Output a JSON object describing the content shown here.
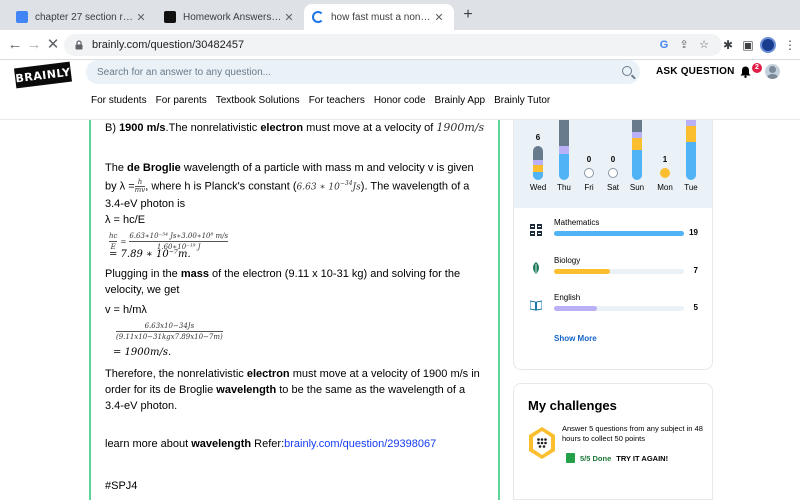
{
  "browser": {
    "tabs": [
      {
        "title": "chapter 27 section review 27.1",
        "favicon_color": "#4285f4"
      },
      {
        "title": "Homework Answers from Subje",
        "favicon_color": "#111111"
      },
      {
        "title": "how fast must a nonrelativistic",
        "favicon_color": "#1a73e8"
      }
    ],
    "url": "brainly.com/question/30482457"
  },
  "header": {
    "logo": "BRAINLY",
    "search_placeholder": "Search for an answer to any question...",
    "ask_question": "ASK QUESTION",
    "notification_count": "2",
    "subnav": [
      "For students",
      "For parents",
      "Textbook Solutions",
      "For teachers",
      "Honor code",
      "Brainly App",
      "Brainly Tutor"
    ]
  },
  "answer": {
    "option_label": "B)",
    "option_value": "1900 m/s",
    "option_text_a": ".The nonrelativistic ",
    "option_bold": "electron",
    "option_text_b": " must move at a velocity of ",
    "option_math": "1900m/s",
    "p2_a": "The ",
    "p2_bold": "de Broglie",
    "p2_b": " wavelength of a particle with mass m and velocity v is given by λ =",
    "p2_frac_num": "h",
    "p2_frac_den": "mv",
    "p2_c": ", where h is Planck's constant (",
    "p2_math": "6.63 ∗ 10",
    "p2_math_exp": "−34",
    "p2_math_unit": "Js",
    "p2_d": "). The wavelength of a 3.4-eV photon is",
    "eq1": "λ = hc/E",
    "eq2_lhs_num": "hc",
    "eq2_lhs_den": "E",
    "eq2_num": "6.63∗10⁻³⁴ Js∗3.00∗10⁸ m/s",
    "eq2_den": "1.60∗10⁻¹⁹ J",
    "eq2_result": "= 7.89 ∗ 10⁻⁷m.",
    "p3_a": "Plugging in the ",
    "p3_bold": "mass",
    "p3_b": " of the electron (9.11 x 10-31 kg) and solving for the velocity, we get",
    "eq3": "v = h/mλ",
    "eq4_num": "6.63x10−34Js",
    "eq4_den": "(9.11x10−31kgx7.89x10−7m)",
    "eq4_result": "= 1900m/s.",
    "p4_a": "Therefore, the nonrelativistic ",
    "p4_bold1": "electron",
    "p4_b": " must move at a velocity of 1900 m/s in order for its de Broglie ",
    "p4_bold2": "wavelength",
    "p4_c": " to be the same as the wavelength of a 3.4-eV photon.",
    "learn_a": "learn more about ",
    "learn_bold": "wavelength",
    "learn_b": " Refer:",
    "learn_link": "brainly.com/question/29398067",
    "tag": "#SPJ4"
  },
  "streak": {
    "days": [
      {
        "label": "Wed",
        "count": "6",
        "show_count": true
      },
      {
        "label": "Thu",
        "count": "",
        "show_count": false
      },
      {
        "label": "Fri",
        "count": "0",
        "show_count": true
      },
      {
        "label": "Sat",
        "count": "0",
        "show_count": true
      },
      {
        "label": "Sun",
        "count": "",
        "show_count": false
      },
      {
        "label": "Mon",
        "count": "1",
        "show_count": true
      },
      {
        "label": "Tue",
        "count": "",
        "show_count": false
      }
    ],
    "subjects": [
      {
        "name": "Mathematics",
        "value": "19",
        "fraction": 1.0,
        "color": "#4fb3f6",
        "icon": "calculator-icon"
      },
      {
        "name": "Biology",
        "value": "7",
        "fraction": 0.43,
        "color": "#fbbe2e",
        "icon": "leaf-icon"
      },
      {
        "name": "English",
        "value": "5",
        "fraction": 0.33,
        "color": "#b9b0f7",
        "icon": "book-icon"
      }
    ],
    "show_more": "Show More"
  },
  "challenges": {
    "title": "My challenges",
    "description": "Answer 5 questions from any subject in 48 hours to collect 50 points",
    "done": "5/5 Done",
    "retry": "TRY IT AGAIN!"
  },
  "colors": {
    "accent_green": "#60d399",
    "blue": "#4fb3f6",
    "yellow": "#fbbe2e",
    "lavender": "#b9b0f7",
    "slate": "#687b8c"
  }
}
